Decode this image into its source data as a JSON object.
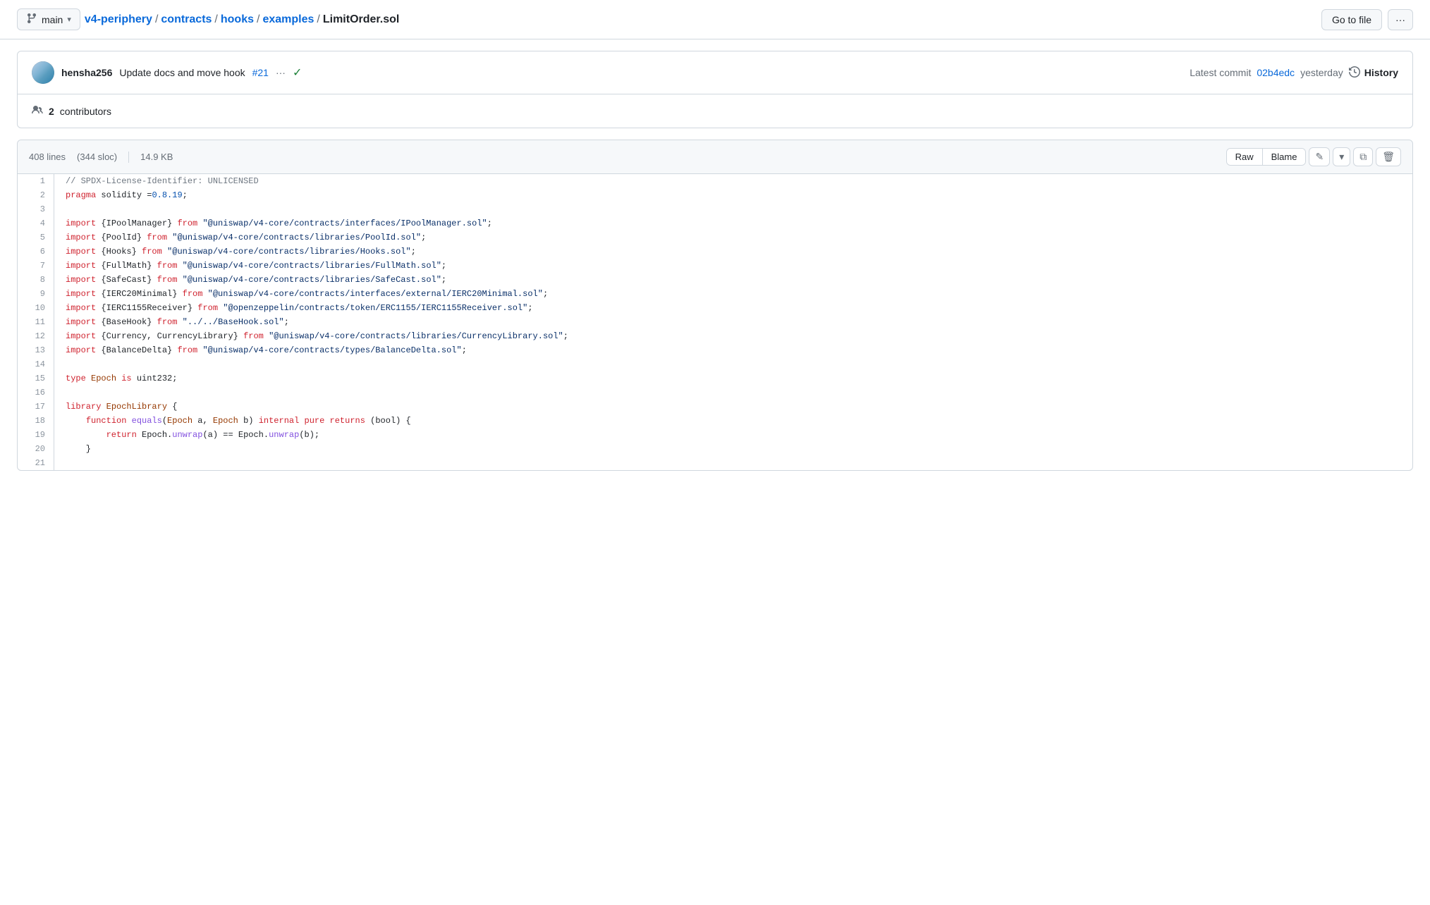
{
  "topbar": {
    "branch": "main",
    "breadcrumb": {
      "repo": "v4-periphery",
      "sep1": "/",
      "contracts": "contracts",
      "sep2": "/",
      "hooks": "hooks",
      "sep3": "/",
      "examples": "examples",
      "sep4": "/",
      "filename": "LimitOrder.sol"
    },
    "goto_file": "Go to file",
    "more_options": "···"
  },
  "commit": {
    "author": "hensha256",
    "message": "Update docs and move hook",
    "pr_link": "#21",
    "ellipsis": "···",
    "check": "✓",
    "latest_label": "Latest commit",
    "hash": "02b4edc",
    "time": "yesterday",
    "history_label": "History"
  },
  "contributors": {
    "count": "2",
    "label": "contributors"
  },
  "file": {
    "lines": "408 lines",
    "sloc": "(344 sloc)",
    "size": "14.9 KB",
    "raw": "Raw",
    "blame": "Blame"
  },
  "code": [
    {
      "num": 1,
      "tokens": [
        {
          "cls": "c-comment",
          "t": "// SPDX-License-Identifier: UNLICENSED"
        }
      ]
    },
    {
      "num": 2,
      "tokens": [
        {
          "cls": "c-pragma",
          "t": "pragma"
        },
        {
          "cls": "c-plain",
          "t": " solidity ="
        },
        {
          "cls": "c-num",
          "t": "0.8.19"
        },
        {
          "cls": "c-plain",
          "t": ";"
        }
      ]
    },
    {
      "num": 3,
      "tokens": []
    },
    {
      "num": 4,
      "tokens": [
        {
          "cls": "c-import",
          "t": "import"
        },
        {
          "cls": "c-plain",
          "t": " {IPoolManager} "
        },
        {
          "cls": "c-keyword",
          "t": "from"
        },
        {
          "cls": "c-plain",
          "t": " "
        },
        {
          "cls": "c-string",
          "t": "\"@uniswap/v4-core/contracts/interfaces/IPoolManager.sol\""
        },
        {
          "cls": "c-plain",
          "t": ";"
        }
      ]
    },
    {
      "num": 5,
      "tokens": [
        {
          "cls": "c-import",
          "t": "import"
        },
        {
          "cls": "c-plain",
          "t": " {PoolId} "
        },
        {
          "cls": "c-keyword",
          "t": "from"
        },
        {
          "cls": "c-plain",
          "t": " "
        },
        {
          "cls": "c-string",
          "t": "\"@uniswap/v4-core/contracts/libraries/PoolId.sol\""
        },
        {
          "cls": "c-plain",
          "t": ";"
        }
      ]
    },
    {
      "num": 6,
      "tokens": [
        {
          "cls": "c-import",
          "t": "import"
        },
        {
          "cls": "c-plain",
          "t": " {Hooks} "
        },
        {
          "cls": "c-keyword",
          "t": "from"
        },
        {
          "cls": "c-plain",
          "t": " "
        },
        {
          "cls": "c-string",
          "t": "\"@uniswap/v4-core/contracts/libraries/Hooks.sol\""
        },
        {
          "cls": "c-plain",
          "t": ";"
        }
      ]
    },
    {
      "num": 7,
      "tokens": [
        {
          "cls": "c-import",
          "t": "import"
        },
        {
          "cls": "c-plain",
          "t": " {FullMath} "
        },
        {
          "cls": "c-keyword",
          "t": "from"
        },
        {
          "cls": "c-plain",
          "t": " "
        },
        {
          "cls": "c-string",
          "t": "\"@uniswap/v4-core/contracts/libraries/FullMath.sol\""
        },
        {
          "cls": "c-plain",
          "t": ";"
        }
      ]
    },
    {
      "num": 8,
      "tokens": [
        {
          "cls": "c-import",
          "t": "import"
        },
        {
          "cls": "c-plain",
          "t": " {SafeCast} "
        },
        {
          "cls": "c-keyword",
          "t": "from"
        },
        {
          "cls": "c-plain",
          "t": " "
        },
        {
          "cls": "c-string",
          "t": "\"@uniswap/v4-core/contracts/libraries/SafeCast.sol\""
        },
        {
          "cls": "c-plain",
          "t": ";"
        }
      ]
    },
    {
      "num": 9,
      "tokens": [
        {
          "cls": "c-import",
          "t": "import"
        },
        {
          "cls": "c-plain",
          "t": " {IERC20Minimal} "
        },
        {
          "cls": "c-keyword",
          "t": "from"
        },
        {
          "cls": "c-plain",
          "t": " "
        },
        {
          "cls": "c-string",
          "t": "\"@uniswap/v4-core/contracts/interfaces/external/IERC20Minimal.sol\""
        },
        {
          "cls": "c-plain",
          "t": ";"
        }
      ]
    },
    {
      "num": 10,
      "tokens": [
        {
          "cls": "c-import",
          "t": "import"
        },
        {
          "cls": "c-plain",
          "t": " {IERC1155Receiver} "
        },
        {
          "cls": "c-keyword",
          "t": "from"
        },
        {
          "cls": "c-plain",
          "t": " "
        },
        {
          "cls": "c-string",
          "t": "\"@openzeppelin/contracts/token/ERC1155/IERC1155Receiver.sol\""
        },
        {
          "cls": "c-plain",
          "t": ";"
        }
      ]
    },
    {
      "num": 11,
      "tokens": [
        {
          "cls": "c-import",
          "t": "import"
        },
        {
          "cls": "c-plain",
          "t": " {BaseHook} "
        },
        {
          "cls": "c-keyword",
          "t": "from"
        },
        {
          "cls": "c-plain",
          "t": " "
        },
        {
          "cls": "c-string",
          "t": "\"../../BaseHook.sol\""
        },
        {
          "cls": "c-plain",
          "t": ";"
        }
      ]
    },
    {
      "num": 12,
      "tokens": [
        {
          "cls": "c-import",
          "t": "import"
        },
        {
          "cls": "c-plain",
          "t": " {Currency, CurrencyLibrary} "
        },
        {
          "cls": "c-keyword",
          "t": "from"
        },
        {
          "cls": "c-plain",
          "t": " "
        },
        {
          "cls": "c-string",
          "t": "\"@uniswap/v4-core/contracts/libraries/CurrencyLibrary.sol\""
        },
        {
          "cls": "c-plain",
          "t": ";"
        }
      ]
    },
    {
      "num": 13,
      "tokens": [
        {
          "cls": "c-import",
          "t": "import"
        },
        {
          "cls": "c-plain",
          "t": " {BalanceDelta} "
        },
        {
          "cls": "c-keyword",
          "t": "from"
        },
        {
          "cls": "c-plain",
          "t": " "
        },
        {
          "cls": "c-string",
          "t": "\"@uniswap/v4-core/contracts/types/BalanceDelta.sol\""
        },
        {
          "cls": "c-plain",
          "t": ";"
        }
      ]
    },
    {
      "num": 14,
      "tokens": []
    },
    {
      "num": 15,
      "tokens": [
        {
          "cls": "c-keyword",
          "t": "type"
        },
        {
          "cls": "c-plain",
          "t": " "
        },
        {
          "cls": "c-type",
          "t": "Epoch"
        },
        {
          "cls": "c-plain",
          "t": " "
        },
        {
          "cls": "c-keyword",
          "t": "is"
        },
        {
          "cls": "c-plain",
          "t": " uint232;"
        }
      ]
    },
    {
      "num": 16,
      "tokens": []
    },
    {
      "num": 17,
      "tokens": [
        {
          "cls": "c-keyword",
          "t": "library"
        },
        {
          "cls": "c-plain",
          "t": " "
        },
        {
          "cls": "c-type",
          "t": "EpochLibrary"
        },
        {
          "cls": "c-plain",
          "t": " {"
        }
      ]
    },
    {
      "num": 18,
      "tokens": [
        {
          "cls": "c-plain",
          "t": "    "
        },
        {
          "cls": "c-keyword",
          "t": "function"
        },
        {
          "cls": "c-plain",
          "t": " "
        },
        {
          "cls": "c-func",
          "t": "equals"
        },
        {
          "cls": "c-plain",
          "t": "("
        },
        {
          "cls": "c-type",
          "t": "Epoch"
        },
        {
          "cls": "c-plain",
          "t": " a, "
        },
        {
          "cls": "c-type",
          "t": "Epoch"
        },
        {
          "cls": "c-plain",
          "t": " b) "
        },
        {
          "cls": "c-keyword",
          "t": "internal pure returns"
        },
        {
          "cls": "c-plain",
          "t": " (bool) {"
        }
      ]
    },
    {
      "num": 19,
      "tokens": [
        {
          "cls": "c-plain",
          "t": "        "
        },
        {
          "cls": "c-keyword",
          "t": "return"
        },
        {
          "cls": "c-plain",
          "t": " Epoch."
        },
        {
          "cls": "c-func",
          "t": "unwrap"
        },
        {
          "cls": "c-plain",
          "t": "(a) == Epoch."
        },
        {
          "cls": "c-func",
          "t": "unwrap"
        },
        {
          "cls": "c-plain",
          "t": "(b);"
        }
      ]
    },
    {
      "num": 20,
      "tokens": [
        {
          "cls": "c-plain",
          "t": "    }"
        }
      ]
    },
    {
      "num": 21,
      "tokens": []
    }
  ]
}
